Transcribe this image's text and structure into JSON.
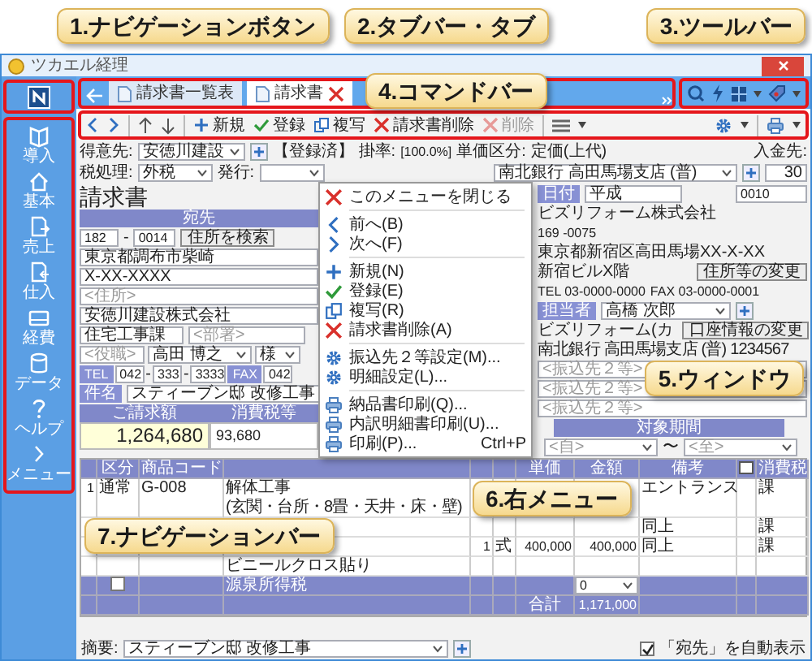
{
  "callouts": [
    {
      "text": "1.ナビゲーションボタン"
    },
    {
      "text": "2.タブバー・タブ"
    },
    {
      "text": "3.ツールバー"
    },
    {
      "text": "4.コマンドバー"
    },
    {
      "text": "5.ウィンドウ"
    },
    {
      "text": "6.右メニュー"
    },
    {
      "text": "7.ナビゲーションバー"
    }
  ],
  "window": {
    "title": "ツカエル経理"
  },
  "nav_bar": {
    "items": [
      {
        "label": "導入"
      },
      {
        "label": "基本"
      },
      {
        "label": "売上"
      },
      {
        "label": "仕入"
      },
      {
        "label": "経費"
      },
      {
        "label": "データ"
      },
      {
        "label": "ヘルプ"
      },
      {
        "label": "メニュー"
      }
    ]
  },
  "tabs": [
    {
      "label": "請求書一覧表",
      "selected": false
    },
    {
      "label": "請求書",
      "selected": true
    }
  ],
  "command_bar": {
    "actions": [
      {
        "label": "新規",
        "kind": "new",
        "disabled": false
      },
      {
        "label": "登録",
        "kind": "save",
        "disabled": false
      },
      {
        "label": "複写",
        "kind": "copy",
        "disabled": false
      },
      {
        "label": "請求書削除",
        "kind": "delete",
        "disabled": false
      },
      {
        "label": "削除",
        "kind": "delete",
        "disabled": true
      }
    ]
  },
  "header": {
    "customer_label": "得意先:",
    "customer": "安徳川建設",
    "status": "【登録済】",
    "rate_label": "掛率:",
    "rate": "[100.0%]",
    "price_class_label": "単価区分:",
    "price_class": "定価(上代)",
    "deposit_label": "入金先:",
    "deposit_account": "南北銀行 高田馬場支店 (普)",
    "tax_label": "税処理:",
    "tax": "外税",
    "issue_label": "発行:",
    "days": "30"
  },
  "document": {
    "title": "請求書",
    "date_label": "日付",
    "date": "平成",
    "number": "0010"
  },
  "recipient": {
    "heading": "宛先",
    "postal_1": "182",
    "postal_sep": "-",
    "postal_2": "0014",
    "search_button": "住所を検索",
    "address_1": "東京都調布市柴崎",
    "address_2": "X-XX-XXXX",
    "address_3_placeholder": "<住所>",
    "company": "安徳川建設株式会社",
    "department": "住宅工事課",
    "department_2_placeholder": "<部署>",
    "title_placeholder": "<役職>",
    "person": "高田 博之",
    "honorific": "様",
    "tel_label": "TEL",
    "tel": [
      "042",
      "333",
      "3333"
    ],
    "tel_sep": "-",
    "fax_label": "FAX",
    "fax": "042",
    "subject_label": "件名",
    "subject": "スティーブン邸 改修工事"
  },
  "totals": {
    "amount_label": "ご請求額",
    "tax_label": "消費税等",
    "amount": "1,264,680",
    "tax": "93,680"
  },
  "sender": {
    "company": "ビズリフォーム株式会社",
    "postal": "169 -0075",
    "address": "東京都新宿区高田馬場XX-X-XX",
    "building": "新宿ビルX階",
    "tel": "TEL 03-0000-0000",
    "fax": "FAX 03-0000-0001",
    "change_button": "住所等の変更",
    "staff_label": "担当者",
    "staff": "高橋 次郎",
    "account_name": "ビズリフォーム(カ",
    "account_button": "口座情報の変更",
    "bank": "南北銀行 高田馬場支店 (普) 1234567",
    "transfer_placeholders": [
      "<振込先２等>",
      "<振込先２等>",
      "<振込先２等>"
    ],
    "period_heading": "対象期間",
    "period_from_placeholder": "<自>",
    "period_sep": "〜",
    "period_to_placeholder": "<至>"
  },
  "lines": {
    "columns": {
      "category": "区分",
      "code": "商品コード",
      "unit_price": "単価",
      "amount": "金額",
      "note": "備考",
      "tax": "消費税"
    },
    "rows": [
      {
        "no": "1",
        "category": "通常",
        "code": "G-008",
        "name": "解体工事",
        "detail": "(玄関・台所・8畳・天井・床・壁)",
        "note": "エントランス",
        "tax": "課"
      },
      {
        "note": "同上",
        "tax": "課"
      },
      {
        "qty": "1",
        "unit": "式",
        "unit_price": "400,000",
        "amount": "400,000",
        "note": "同上",
        "tax": "課"
      },
      {
        "name": "ビニールクロス貼り"
      }
    ],
    "withholding": {
      "checked": false,
      "label": "源泉所得税",
      "amount": "0"
    },
    "total": {
      "label": "合計",
      "amount": "1,171,000"
    }
  },
  "footer": {
    "summary_label": "摘要:",
    "summary": "スティーブン邸 改修工事",
    "auto_show": {
      "label": "「宛先」を自動表示",
      "checked": true
    }
  },
  "context_menu": {
    "items": [
      {
        "kind": "close",
        "label": "このメニューを閉じる"
      },
      {
        "kind": "separator"
      },
      {
        "kind": "prev",
        "label": "前へ(B)"
      },
      {
        "kind": "next",
        "label": "次へ(F)"
      },
      {
        "kind": "separator"
      },
      {
        "kind": "new",
        "label": "新規(N)"
      },
      {
        "kind": "save",
        "label": "登録(E)"
      },
      {
        "kind": "copy",
        "label": "複写(R)"
      },
      {
        "kind": "delete",
        "label": "請求書削除(A)"
      },
      {
        "kind": "separator"
      },
      {
        "kind": "gear",
        "label": "振込先２等設定(M)..."
      },
      {
        "kind": "gear",
        "label": "明細設定(L)..."
      },
      {
        "kind": "separator"
      },
      {
        "kind": "print",
        "label": "納品書印刷(Q)..."
      },
      {
        "kind": "print",
        "label": "内訳明細書印刷(U)..."
      },
      {
        "kind": "print",
        "label": "印刷(P)...",
        "shortcut": "Ctrl+P"
      }
    ]
  }
}
